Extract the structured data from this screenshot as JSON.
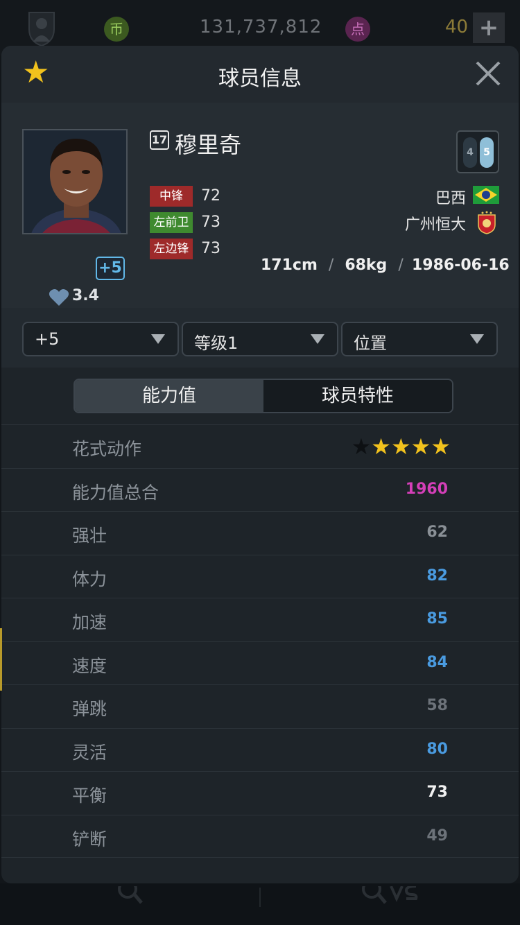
{
  "topbar": {
    "coin_icon_label": "币",
    "coins": "131,737,812",
    "point_icon_label": "点",
    "points": "40",
    "plus_label": "+"
  },
  "modal": {
    "title": "球员信息",
    "fav_icon": "star-icon",
    "close_icon": "close-icon"
  },
  "player": {
    "season_badge": "17",
    "name": "穆里奇",
    "enhance_badge": "+5",
    "rating": "3.4",
    "weak_foot": "4",
    "strong_foot": "5",
    "positions": [
      {
        "label": "中锋",
        "value": "72",
        "color": "#9e2a2a"
      },
      {
        "label": "左前卫",
        "value": "73",
        "color": "#3f8a2f"
      },
      {
        "label": "左边锋",
        "value": "73",
        "color": "#9e2a2a"
      }
    ],
    "nation": "巴西",
    "club": "广州恒大",
    "height": "171cm",
    "weight": "68kg",
    "separator": "/",
    "birthday": "1986-06-16"
  },
  "filters": {
    "enhance": "+5",
    "level": "等级1",
    "position": "位置"
  },
  "tabs": {
    "ability": "能力值",
    "traits": "球员特性"
  },
  "stats": [
    {
      "label": "花式动作",
      "value": "",
      "stars_filled": 4,
      "stars_total": 5
    },
    {
      "label": "能力值总合",
      "value": "1960",
      "color": "#d43fb8"
    },
    {
      "label": "强壮",
      "value": "62",
      "color": "#8a9096"
    },
    {
      "label": "体力",
      "value": "82",
      "color": "#4a9be0"
    },
    {
      "label": "加速",
      "value": "85",
      "color": "#4a9be0"
    },
    {
      "label": "速度",
      "value": "84",
      "color": "#4a9be0"
    },
    {
      "label": "弹跳",
      "value": "58",
      "color": "#6d737a"
    },
    {
      "label": "灵活",
      "value": "80",
      "color": "#4a9be0"
    },
    {
      "label": "平衡",
      "value": "73",
      "color": "#f0f0f0"
    },
    {
      "label": "铲断",
      "value": "49",
      "color": "#6d737a"
    }
  ]
}
